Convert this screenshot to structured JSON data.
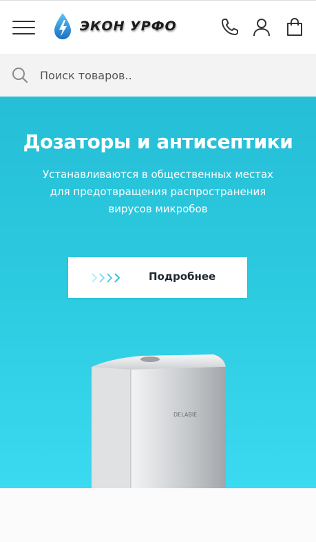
{
  "header": {
    "menu_icon": "hamburger-icon",
    "logo_text": "ЭКОН УРФО",
    "logo_icon": "water-drop-lightning-icon",
    "icons": [
      "phone-icon",
      "user-icon",
      "shopping-bag-icon"
    ]
  },
  "search": {
    "icon": "search-icon",
    "placeholder": "Поиск товаров.."
  },
  "banner": {
    "title": "Дозаторы и антисептики",
    "subtitle_lines": [
      "Устанавливаются в общественных местах",
      "для предотвращения распространения",
      "вирусов микробов"
    ],
    "button_label": "Подробнее",
    "button_icon": "chevrons-right-icon",
    "product_brand": "DELABIE",
    "colors": {
      "background_top": "#25bed6",
      "background_bottom": "#3bdaf0",
      "arrow": "#2fc3da"
    }
  }
}
